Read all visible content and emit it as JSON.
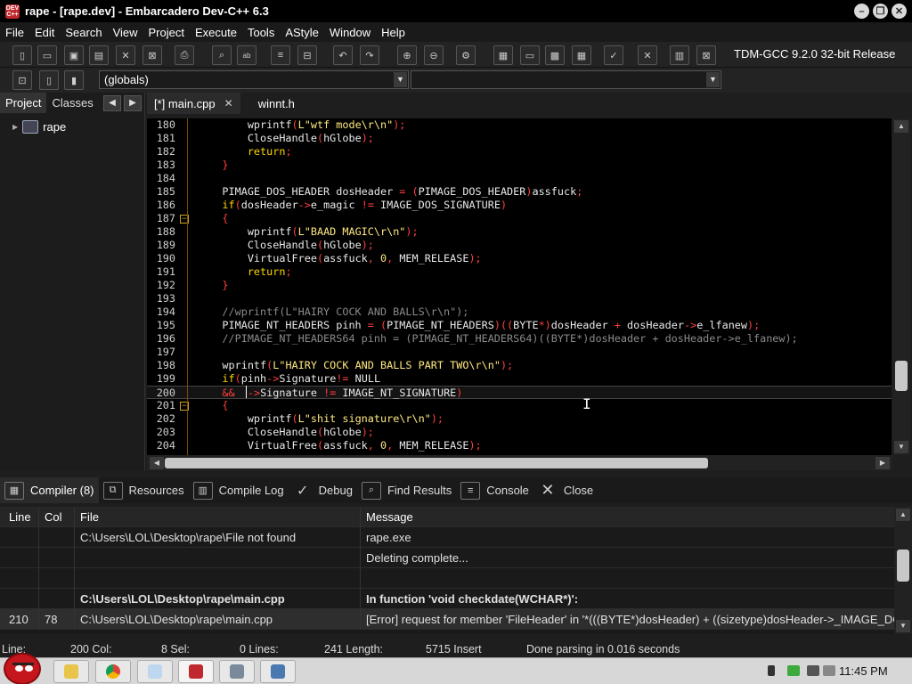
{
  "window": {
    "title": "rape - [rape.dev] - Embarcadero Dev-C++ 6.3",
    "icon_text": "DEV C++"
  },
  "menu": [
    "File",
    "Edit",
    "Search",
    "View",
    "Project",
    "Execute",
    "Tools",
    "AStyle",
    "Window",
    "Help"
  ],
  "toolbar": {
    "compiler": "TDM-GCC 9.2.0 32-bit Release",
    "scope": "(globals)"
  },
  "left_panel": {
    "tabs": [
      "Project",
      "Classes"
    ],
    "tree_root": "rape"
  },
  "editor_tabs": [
    {
      "label": "[*] main.cpp"
    },
    {
      "label": "winnt.h"
    }
  ],
  "code_lines": [
    {
      "n": "180",
      "fold": false,
      "code": [
        [
          "",
          "        "
        ],
        [
          "",
          "wprintf"
        ],
        [
          "sym",
          "("
        ],
        [
          "str",
          "L\"wtf mode\\r\\n\""
        ],
        [
          "sym",
          ");"
        ]
      ]
    },
    {
      "n": "181",
      "fold": false,
      "code": [
        [
          "",
          "        CloseHandle"
        ],
        [
          "sym",
          "("
        ],
        [
          "",
          "hGlobe"
        ],
        [
          "sym",
          ");"
        ]
      ]
    },
    {
      "n": "182",
      "fold": false,
      "code": [
        [
          "",
          "        "
        ],
        [
          "kw",
          "return"
        ],
        [
          "sym",
          ";"
        ]
      ]
    },
    {
      "n": "183",
      "fold": false,
      "code": [
        [
          "",
          "    "
        ],
        [
          "sym",
          "}"
        ]
      ]
    },
    {
      "n": "184",
      "fold": false,
      "code": [
        [
          "",
          ""
        ]
      ]
    },
    {
      "n": "185",
      "fold": false,
      "code": [
        [
          "",
          "    PIMAGE_DOS_HEADER dosHeader "
        ],
        [
          "sym",
          "="
        ],
        [
          "",
          " "
        ],
        [
          "sym",
          "("
        ],
        [
          "",
          "PIMAGE_DOS_HEADER"
        ],
        [
          "sym",
          ")"
        ],
        [
          "",
          "assfuck"
        ],
        [
          "sym",
          ";"
        ]
      ]
    },
    {
      "n": "186",
      "fold": false,
      "code": [
        [
          "",
          "    "
        ],
        [
          "kw",
          "if"
        ],
        [
          "sym",
          "("
        ],
        [
          "",
          "dosHeader"
        ],
        [
          "sym",
          "->"
        ],
        [
          "",
          "e_magic "
        ],
        [
          "sym",
          "!="
        ],
        [
          "",
          " IMAGE_DOS_SIGNATURE"
        ],
        [
          "sym",
          ")"
        ]
      ]
    },
    {
      "n": "187",
      "fold": true,
      "code": [
        [
          "",
          "    "
        ],
        [
          "sym",
          "{"
        ]
      ]
    },
    {
      "n": "188",
      "fold": false,
      "code": [
        [
          "",
          "        wprintf"
        ],
        [
          "sym",
          "("
        ],
        [
          "str",
          "L\"BAAD MAGIC\\r\\n\""
        ],
        [
          "sym",
          ");"
        ]
      ]
    },
    {
      "n": "189",
      "fold": false,
      "code": [
        [
          "",
          "        CloseHandle"
        ],
        [
          "sym",
          "("
        ],
        [
          "",
          "hGlobe"
        ],
        [
          "sym",
          ");"
        ]
      ]
    },
    {
      "n": "190",
      "fold": false,
      "code": [
        [
          "",
          "        VirtualFree"
        ],
        [
          "sym",
          "("
        ],
        [
          "",
          "assfuck"
        ],
        [
          "sym",
          ","
        ],
        [
          "",
          " "
        ],
        [
          "str",
          "0"
        ],
        [
          "sym",
          ","
        ],
        [
          "",
          " MEM_RELEASE"
        ],
        [
          "sym",
          ");"
        ]
      ]
    },
    {
      "n": "191",
      "fold": false,
      "code": [
        [
          "",
          "        "
        ],
        [
          "kw",
          "return"
        ],
        [
          "sym",
          ";"
        ]
      ]
    },
    {
      "n": "192",
      "fold": false,
      "code": [
        [
          "",
          "    "
        ],
        [
          "sym",
          "}"
        ]
      ]
    },
    {
      "n": "193",
      "fold": false,
      "code": [
        [
          "",
          ""
        ]
      ]
    },
    {
      "n": "194",
      "fold": false,
      "code": [
        [
          "cm",
          "    //wprintf(L\"HAIRY COCK AND BALLS\\r\\n\");"
        ]
      ]
    },
    {
      "n": "195",
      "fold": false,
      "code": [
        [
          "",
          "    PIMAGE_NT_HEADERS pinh "
        ],
        [
          "sym",
          "="
        ],
        [
          "",
          " "
        ],
        [
          "sym",
          "("
        ],
        [
          "",
          "PIMAGE_NT_HEADERS"
        ],
        [
          "sym",
          ")(("
        ],
        [
          "",
          "BYTE"
        ],
        [
          "sym",
          "*)"
        ],
        [
          "",
          "dosHeader "
        ],
        [
          "sym",
          "+"
        ],
        [
          "",
          " dosHeader"
        ],
        [
          "sym",
          "->"
        ],
        [
          "",
          "e_lfanew"
        ],
        [
          "sym",
          ");"
        ]
      ]
    },
    {
      "n": "196",
      "fold": false,
      "code": [
        [
          "cm",
          "    //PIMAGE_NT_HEADERS64 pinh = (PIMAGE_NT_HEADERS64)((BYTE*)dosHeader + dosHeader->e_lfanew);"
        ]
      ]
    },
    {
      "n": "197",
      "fold": false,
      "code": [
        [
          "",
          ""
        ]
      ]
    },
    {
      "n": "198",
      "fold": false,
      "code": [
        [
          "",
          "    wprintf"
        ],
        [
          "sym",
          "("
        ],
        [
          "str",
          "L\"HAIRY COCK AND BALLS PART TWO\\r\\n\""
        ],
        [
          "sym",
          ");"
        ]
      ]
    },
    {
      "n": "199",
      "fold": false,
      "code": [
        [
          "",
          "    "
        ],
        [
          "kw",
          "if"
        ],
        [
          "sym",
          "("
        ],
        [
          "",
          "pinh"
        ],
        [
          "sym",
          "->"
        ],
        [
          "",
          "Signature"
        ],
        [
          "sym",
          "!="
        ],
        [
          "",
          " NULL"
        ]
      ]
    },
    {
      "n": "200",
      "fold": false,
      "cur": true,
      "code": [
        [
          "",
          "    "
        ],
        [
          "sym",
          "&&"
        ],
        [
          "",
          "  "
        ],
        [
          "sym",
          "->"
        ],
        [
          "",
          "Signature "
        ],
        [
          "sym",
          "!="
        ],
        [
          "",
          " IMAGE_NT_SIGNATURE"
        ],
        [
          "sym",
          ")"
        ]
      ]
    },
    {
      "n": "201",
      "fold": true,
      "code": [
        [
          "",
          "    "
        ],
        [
          "sym",
          "{"
        ]
      ]
    },
    {
      "n": "202",
      "fold": false,
      "code": [
        [
          "",
          "        wprintf"
        ],
        [
          "sym",
          "("
        ],
        [
          "str",
          "L\"shit signature\\r\\n\""
        ],
        [
          "sym",
          ");"
        ]
      ]
    },
    {
      "n": "203",
      "fold": false,
      "code": [
        [
          "",
          "        CloseHandle"
        ],
        [
          "sym",
          "("
        ],
        [
          "",
          "hGlobe"
        ],
        [
          "sym",
          ");"
        ]
      ]
    },
    {
      "n": "204",
      "fold": false,
      "code": [
        [
          "",
          "        VirtualFree"
        ],
        [
          "sym",
          "("
        ],
        [
          "",
          "assfuck"
        ],
        [
          "sym",
          ","
        ],
        [
          "",
          " "
        ],
        [
          "str",
          "0"
        ],
        [
          "sym",
          ","
        ],
        [
          "",
          " MEM_RELEASE"
        ],
        [
          "sym",
          ");"
        ]
      ]
    }
  ],
  "bottom_tabs": {
    "compiler": "Compiler (8)",
    "resources": "Resources",
    "compile_log": "Compile Log",
    "debug": "Debug",
    "find_results": "Find Results",
    "console": "Console",
    "close": "Close"
  },
  "messages": {
    "headers": {
      "line": "Line",
      "col": "Col",
      "file": "File",
      "message": "Message"
    },
    "rows": [
      {
        "line": "",
        "col": "",
        "file": "C:\\Users\\LOL\\Desktop\\rape\\File not found",
        "message": "rape.exe"
      },
      {
        "line": "",
        "col": "",
        "file": "",
        "message": "Deleting complete..."
      },
      {
        "line": "",
        "col": "",
        "file": "",
        "message": ""
      },
      {
        "line": "",
        "col": "",
        "file": "C:\\Users\\LOL\\Desktop\\rape\\main.cpp",
        "message": "In function 'void checkdate(WCHAR*)':",
        "bold": true
      },
      {
        "line": "210",
        "col": "78",
        "file": "C:\\Users\\LOL\\Desktop\\rape\\main.cpp",
        "message": "[Error] request for member 'FileHeader' in '*(((BYTE*)dosHeader) + ((sizetype)dosHeader->_IMAGE_DO...",
        "sel": true
      }
    ]
  },
  "status": {
    "line_label": "Line:",
    "col_label": "200 Col:",
    "sel_label": "8 Sel:",
    "lines_label": "0 Lines:",
    "length_label": "241 Length:",
    "insert_label": "5715 Insert",
    "parse_text": "Done parsing in 0.016 seconds"
  },
  "taskbar": {
    "clock": "11:45 PM"
  }
}
